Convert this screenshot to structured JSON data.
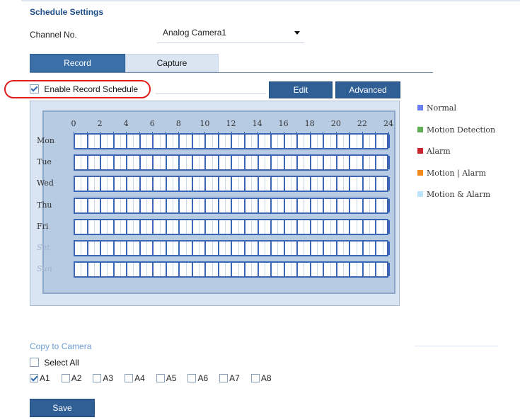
{
  "page": {
    "title": "Schedule Settings"
  },
  "channel": {
    "label": "Channel No.",
    "selected": "Analog Camera1"
  },
  "tabs": [
    {
      "label": "Record",
      "active": true
    },
    {
      "label": "Capture",
      "active": false
    }
  ],
  "record_schedule": {
    "enable_label": "Enable Record Schedule",
    "enabled": true
  },
  "buttons": {
    "edit": "Edit",
    "advanced": "Advanced",
    "save": "Save"
  },
  "schedule": {
    "hours": [
      "0",
      "2",
      "4",
      "6",
      "8",
      "10",
      "12",
      "14",
      "16",
      "18",
      "20",
      "22",
      "24"
    ],
    "days": [
      "Mon",
      "Tue",
      "Wed",
      "Thu",
      "Fri",
      "Sat",
      "Sun"
    ]
  },
  "legend": [
    {
      "label": "Normal",
      "color": "#6b7ff0"
    },
    {
      "label": "Motion Detection",
      "color": "#5fae55"
    },
    {
      "label": "Alarm",
      "color": "#c8262f"
    },
    {
      "label": "Motion | Alarm",
      "color": "#ef8a1a"
    },
    {
      "label": "Motion & Alarm",
      "color": "#bfe3fb"
    }
  ],
  "copy": {
    "title": "Copy to Camera",
    "select_all": "Select All",
    "cameras": [
      {
        "label": "A1",
        "checked": true
      },
      {
        "label": "A2",
        "checked": false
      },
      {
        "label": "A3",
        "checked": false
      },
      {
        "label": "A4",
        "checked": false
      },
      {
        "label": "A5",
        "checked": false
      },
      {
        "label": "A6",
        "checked": false
      },
      {
        "label": "A7",
        "checked": false
      },
      {
        "label": "A8",
        "checked": false
      }
    ]
  }
}
